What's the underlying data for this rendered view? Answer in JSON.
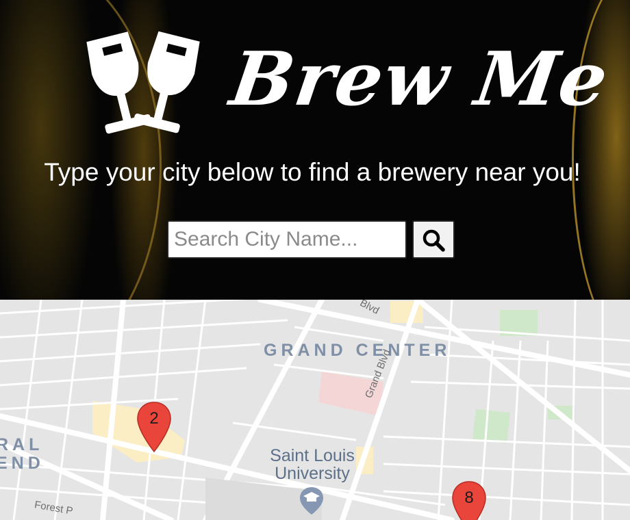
{
  "header": {
    "brand": "Brew Me",
    "logo_icon": "wine-glasses-cheers-icon",
    "tagline": "Type your city below to find a brewery near you!"
  },
  "search": {
    "placeholder": "Search City Name...",
    "value": "",
    "button_icon": "search-icon"
  },
  "map": {
    "neighborhood": "GRAND CENTER",
    "neighborhood_partial_line1": "RAL",
    "neighborhood_partial_line2": "END",
    "poi_line1": "Saint Louis",
    "poi_line2": "University",
    "poi_icon": "university-icon",
    "streets": {
      "grand_blvd": "Grand Blvd",
      "blvd_top": "Blvd",
      "forest_park": "Forest P"
    },
    "markers": [
      {
        "label": "2",
        "color": "#e9453a"
      },
      {
        "label": "8",
        "color": "#e9453a"
      }
    ]
  }
}
